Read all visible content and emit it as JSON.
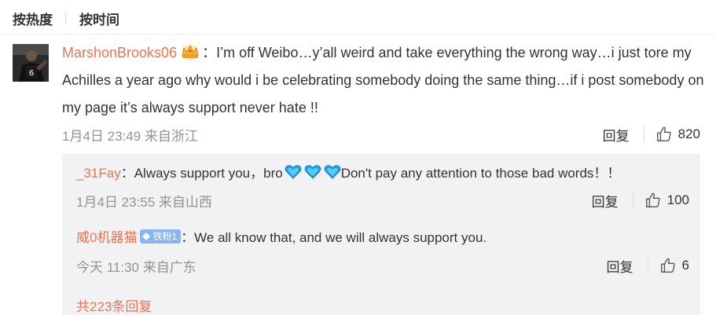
{
  "sort": {
    "hot_label": "按热度",
    "time_label": "按时间"
  },
  "main_comment": {
    "avatar": "player-avatar",
    "username": "MarshonBrooks06",
    "badge_icon": "crown-icon",
    "colon": "：",
    "text": "I’m off Weibo…y’all weird and take everything the wrong way…i just tore my Achilles a year ago why would i be celebrating somebody doing the same thing…if i post somebody on my page it’s always support never hate !!",
    "meta": "1月4日 23:49 来自浙江",
    "reply_label": "回复",
    "like_count": "820"
  },
  "replies": [
    {
      "username": "_31Fay",
      "colon": "：",
      "text_before": "Always support you，bro",
      "emoji": [
        "blue-heart-icon",
        "blue-heart-icon",
        "blue-heart-icon"
      ],
      "text_after": "Don't pay any attention to those bad words！！",
      "meta": "1月4日 23:55 来自山西",
      "reply_label": "回复",
      "like_count": "100"
    },
    {
      "username": "威0机器猫",
      "badge": "铁粉1",
      "colon": "：",
      "text": "We all know that, and we will always support you.",
      "meta": "今天 11:30 来自广东",
      "reply_label": "回复",
      "like_count": "6"
    }
  ],
  "more_replies": "共223条回复",
  "colors": {
    "username": "#eb7350",
    "meta": "#939393",
    "reply_bg": "#f2f2f5",
    "heart": "#1fa3e6",
    "badge": "#8ab5ef"
  }
}
